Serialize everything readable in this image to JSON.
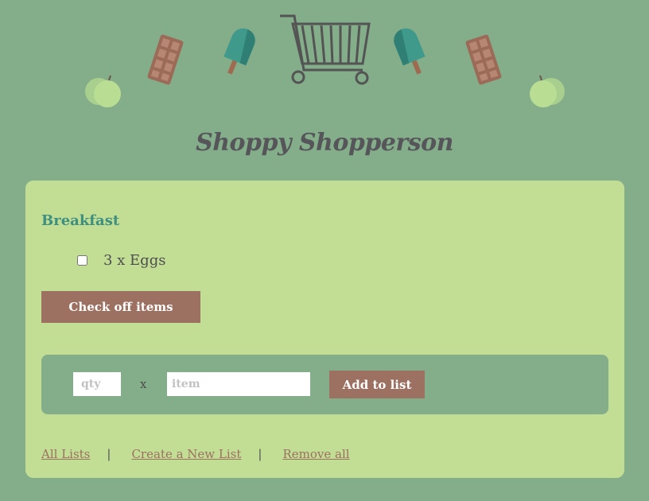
{
  "header": {
    "title": "Shoppy Shopperson"
  },
  "decorations": [
    "apple-icon",
    "chocolate-bar-icon",
    "popsicle-icon",
    "shopping-cart-icon",
    "popsicle-icon",
    "chocolate-bar-icon",
    "apple-icon"
  ],
  "list": {
    "name": "Breakfast",
    "items": [
      {
        "qty": "3",
        "name": "Eggs",
        "text": "3 x Eggs",
        "checked": false
      }
    ],
    "check_off_label": "Check off items"
  },
  "add_form": {
    "qty_placeholder": "qty",
    "times_symbol": "x",
    "item_placeholder": "item",
    "add_label": "Add to list"
  },
  "footer": {
    "links": [
      "All Lists",
      "Create a New List",
      "Remove all"
    ],
    "separator": "|"
  },
  "colors": {
    "background": "#84ad8a",
    "card": "#c2de95",
    "accent_brown": "#9c7161",
    "heading_teal": "#3f8f81",
    "title_gray": "#55555a"
  }
}
